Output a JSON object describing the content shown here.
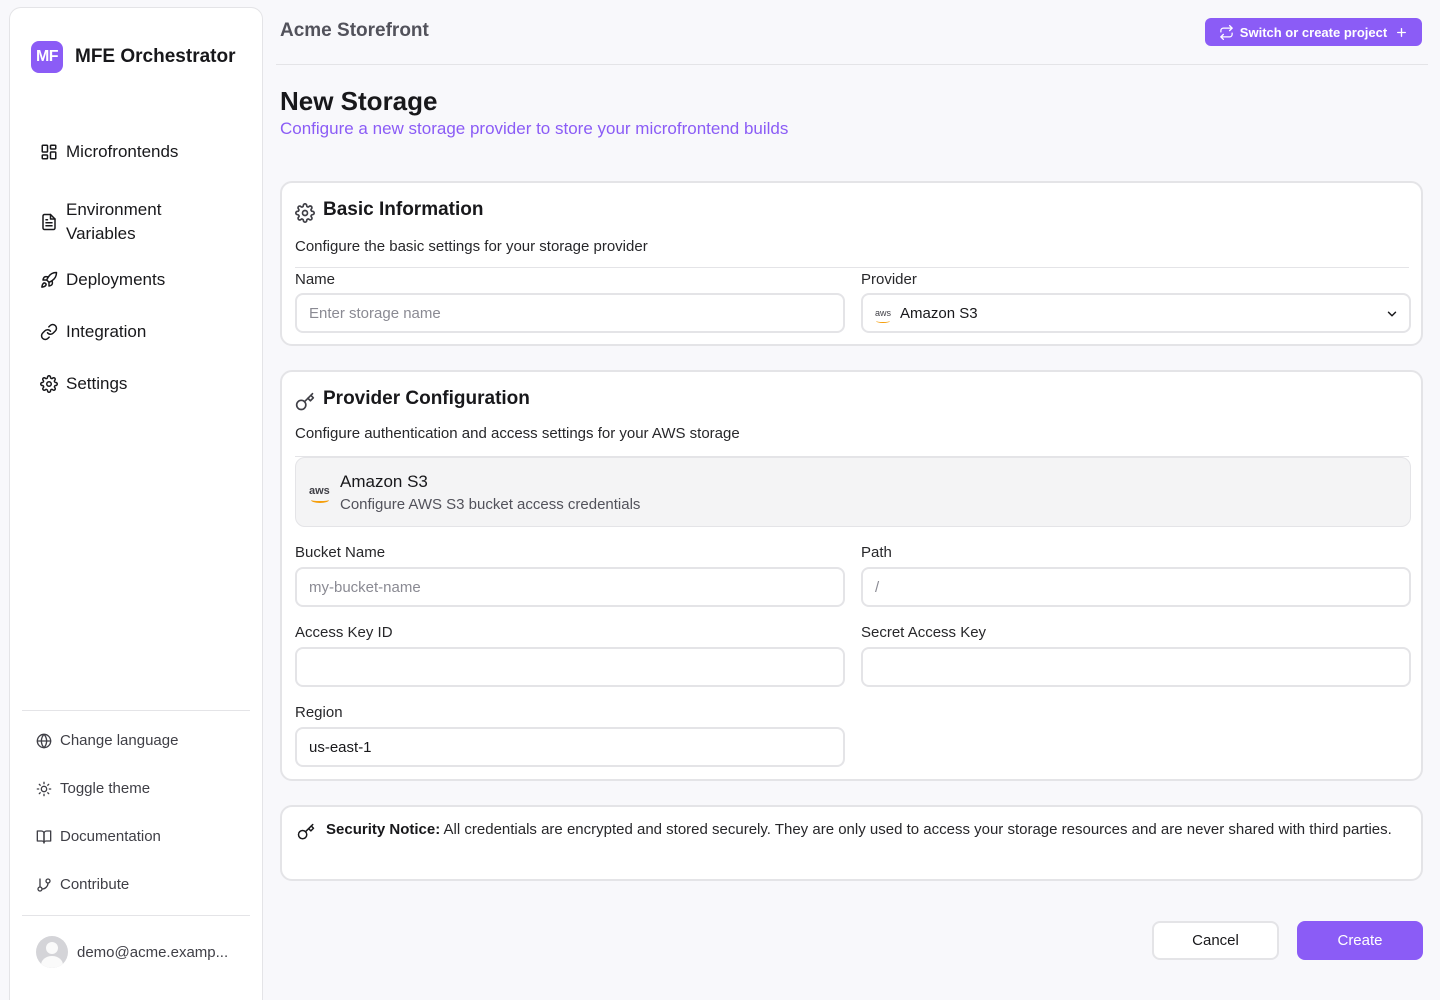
{
  "brand": {
    "logo_text": "MF",
    "name": "MFE Orchestrator"
  },
  "sidebar": {
    "items": [
      {
        "label": "Microfrontends",
        "icon": "grid-icon"
      },
      {
        "label": "Environment Variables",
        "icon": "file-text-icon"
      },
      {
        "label": "Deployments",
        "icon": "rocket-icon"
      },
      {
        "label": "Integration",
        "icon": "link-icon"
      },
      {
        "label": "Settings",
        "icon": "gear-icon"
      }
    ],
    "utilities": [
      {
        "label": "Change language",
        "icon": "globe-icon"
      },
      {
        "label": "Toggle theme",
        "icon": "sun-icon"
      },
      {
        "label": "Documentation",
        "icon": "book-icon"
      },
      {
        "label": "Contribute",
        "icon": "git-branch-icon"
      }
    ],
    "user_email": "demo@acme.examp..."
  },
  "header": {
    "project_name": "Acme Storefront",
    "switch_label": "Switch or create project"
  },
  "page": {
    "title": "New Storage",
    "subtitle": "Configure a new storage provider to store your microfrontend builds"
  },
  "basic": {
    "title": "Basic Information",
    "description": "Configure the basic settings for your storage provider",
    "name_label": "Name",
    "name_placeholder": "Enter storage name",
    "provider_label": "Provider",
    "provider_value": "Amazon S3",
    "provider_logo": "aws"
  },
  "provider_config": {
    "title": "Provider Configuration",
    "description": "Configure authentication and access settings for your AWS storage",
    "box_logo": "aws",
    "box_title": "Amazon S3",
    "box_desc": "Configure AWS S3 bucket access credentials",
    "bucket_label": "Bucket Name",
    "bucket_placeholder": "my-bucket-name",
    "path_label": "Path",
    "path_placeholder": "/",
    "access_key_label": "Access Key ID",
    "access_key_value": "",
    "secret_key_label": "Secret Access Key",
    "secret_key_value": "",
    "region_label": "Region",
    "region_value": "us-east-1"
  },
  "notice": {
    "title": "Security Notice:",
    "text": "All credentials are encrypted and stored securely. They are only used to access your storage resources and are never shared with third parties."
  },
  "actions": {
    "cancel": "Cancel",
    "create": "Create"
  },
  "colors": {
    "accent": "#8b5cf6",
    "border": "#e4e4e7",
    "background": "#f8f8fb"
  }
}
